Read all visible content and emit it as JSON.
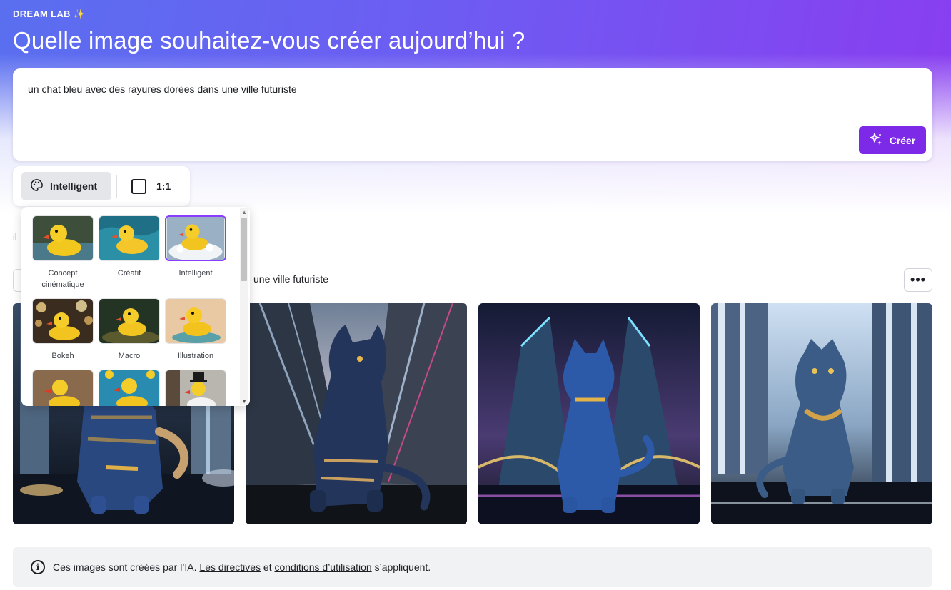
{
  "app": {
    "brand_label": "DREAM LAB",
    "brand_icon": "sparkles-icon"
  },
  "hero": {
    "headline": "Quelle image souhaitez-vous créer aujourd’hui ?"
  },
  "prompt": {
    "value": "un chat bleu avec des rayures dorées dans une ville futuriste",
    "create_label": "Créer",
    "create_icon": "magic-sparkle-icon",
    "accent_color": "#7d2ae8"
  },
  "toolbar": {
    "style_label": "Intelligent",
    "style_icon": "palette-icon",
    "ratio_label": "1:1",
    "ratio_icon": "square-icon"
  },
  "results": {
    "hint_fragment": "il",
    "prompt_echo": "une ville futuriste",
    "more_label": "•••",
    "images": [
      {
        "alt": "chat bleu à rayures dorées, ville futuriste 1"
      },
      {
        "alt": "chat bleu à rayures dorées, ville futuriste 2"
      },
      {
        "alt": "chat bleu à rayures dorées, ville futuriste 3"
      },
      {
        "alt": "chat bleu à rayures dorées, ville futuriste 4"
      }
    ]
  },
  "style_picker": {
    "selected": "Intelligent",
    "selected_color": "#8b3dff",
    "styles": [
      {
        "label": "Concept cinématique"
      },
      {
        "label": "Créatif"
      },
      {
        "label": "Intelligent"
      },
      {
        "label": "Bokeh"
      },
      {
        "label": "Macro"
      },
      {
        "label": "Illustration"
      },
      {
        "label": ""
      },
      {
        "label": ""
      },
      {
        "label": ""
      }
    ]
  },
  "notice": {
    "prefix": "Ces images sont créées par l’IA.",
    "link1": "Les directives",
    "middle": "et",
    "link2": "conditions d’utilisation",
    "suffix": "s’appliquent.",
    "icon": "info-icon"
  }
}
